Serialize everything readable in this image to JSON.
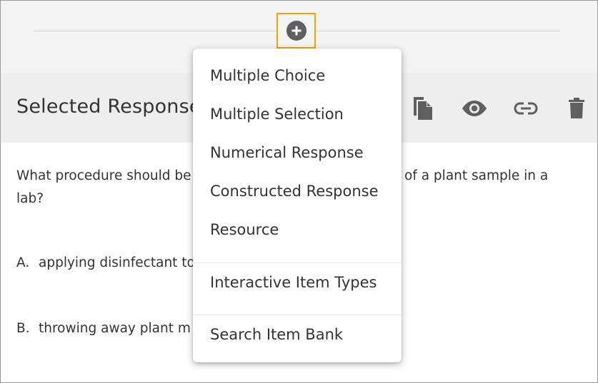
{
  "colors": {
    "focus_ring": "#f0a500",
    "icon": "#5f5f5f",
    "header_bg": "#eeeeee",
    "top_band_bg": "#f3f3f3"
  },
  "add_button": {
    "icon": "plus-circle-icon"
  },
  "item": {
    "title": "Selected Response",
    "toolbar_icons": [
      "copy-icon",
      "eye-icon",
      "link-icon",
      "trash-icon"
    ]
  },
  "question": {
    "text_left": "What procedure should be",
    "text_right": "of a plant sample in a",
    "text_cont": "lab?"
  },
  "options": [
    {
      "letter": "A.",
      "text": "applying disinfectant to"
    },
    {
      "letter": "B.",
      "text": "throwing away plant m"
    }
  ],
  "menu": {
    "items": [
      "Multiple Choice",
      "Multiple Selection",
      "Numerical Response",
      "Constructed Response",
      "Resource",
      "Interactive Item Types",
      "Search Item Bank"
    ]
  }
}
